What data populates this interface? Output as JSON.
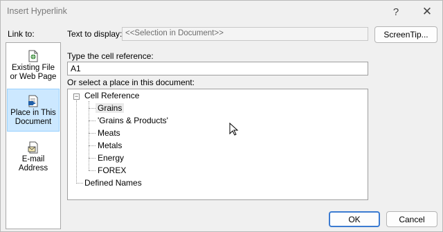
{
  "window": {
    "title": "Insert Hyperlink",
    "help_glyph": "?",
    "close_glyph": "✕"
  },
  "sidebar": {
    "label": "Link to:",
    "items": [
      {
        "line1": "Existing File",
        "line2": "or Web Page",
        "icon": "existing-file-icon"
      },
      {
        "line1": "Place in This",
        "line2": "Document",
        "icon": "place-in-document-icon",
        "selected": true
      },
      {
        "line1": "E-mail",
        "line2": "Address",
        "icon": "email-address-icon"
      }
    ]
  },
  "text_to_display": {
    "label": "Text to display:",
    "value": "<<Selection in Document>>"
  },
  "screentip_label": "ScreenTip...",
  "cell_reference": {
    "label": "Type the cell reference:",
    "value": "A1"
  },
  "place": {
    "label": "Or select a place in this document:",
    "root": "Cell Reference",
    "expander": "−",
    "sheets": [
      "Grains",
      "'Grains & Products'",
      "Meats",
      "Metals",
      "Energy",
      "FOREX"
    ],
    "selected_sheet": "Grains",
    "defined_names": "Defined Names"
  },
  "buttons": {
    "ok": "OK",
    "cancel": "Cancel"
  },
  "colors": {
    "selection": "#cce8ff",
    "accent_border": "#3b7bd1"
  }
}
